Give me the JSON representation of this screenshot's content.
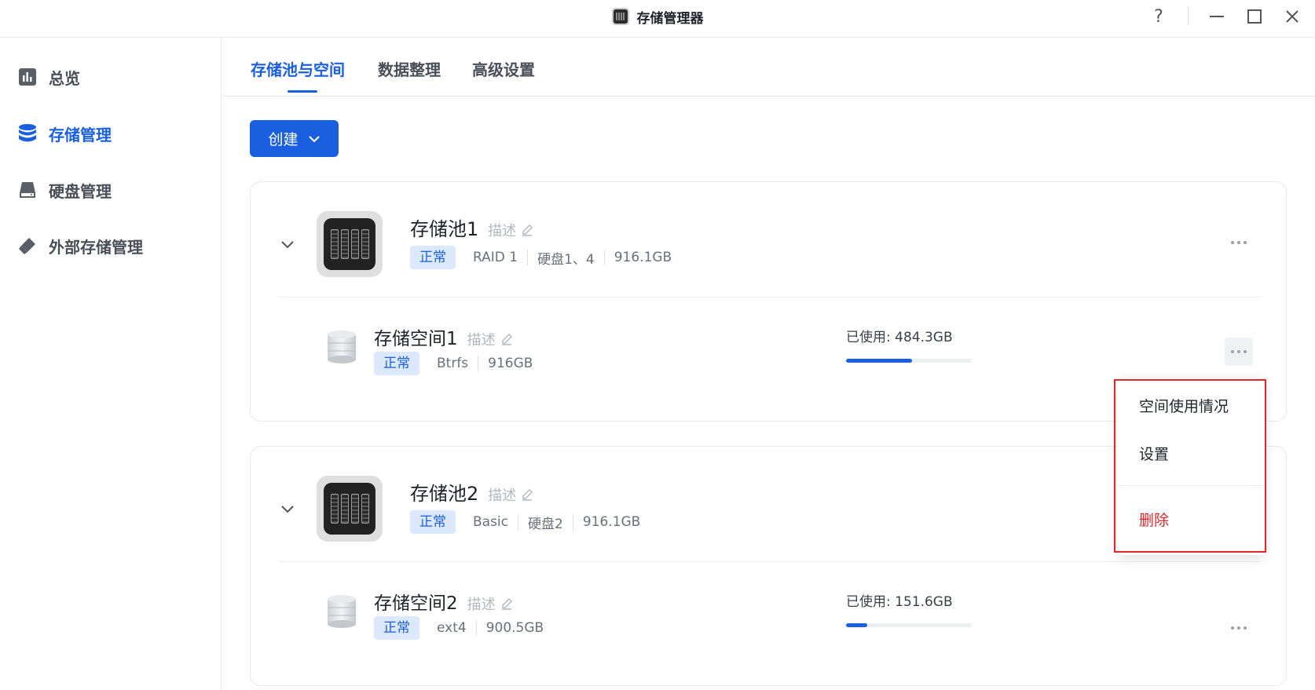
{
  "window": {
    "title": "存储管理器",
    "help": "?",
    "minimize": "—",
    "maximize": "☐",
    "close": "✕"
  },
  "sidebar": {
    "items": [
      {
        "label": "总览",
        "icon": "bar-chart-icon"
      },
      {
        "label": "存储管理",
        "icon": "database-icon",
        "active": true
      },
      {
        "label": "硬盘管理",
        "icon": "hard-disk-icon"
      },
      {
        "label": "外部存储管理",
        "icon": "usb-drive-icon"
      }
    ]
  },
  "tabs": [
    {
      "label": "存储池与空间",
      "active": true
    },
    {
      "label": "数据整理"
    },
    {
      "label": "高级设置"
    }
  ],
  "toolbar": {
    "create_label": "创建"
  },
  "pools": [
    {
      "name": "存储池1",
      "desc": "描述",
      "status": "正常",
      "raid": "RAID 1",
      "disks": "硬盘1、4",
      "size": "916.1GB",
      "volume": {
        "name": "存储空间1",
        "desc": "描述",
        "status": "正常",
        "fs": "Btrfs",
        "size": "916GB",
        "used_label": "已使用: 484.3GB",
        "used_fraction": 0.528
      }
    },
    {
      "name": "存储池2",
      "desc": "描述",
      "status": "正常",
      "raid": "Basic",
      "disks": "硬盘2",
      "size": "916.1GB",
      "volume": {
        "name": "存储空间2",
        "desc": "描述",
        "status": "正常",
        "fs": "ext4",
        "size": "900.5GB",
        "used_label": "已使用: 151.6GB",
        "used_fraction": 0.168
      }
    }
  ],
  "context_menu": {
    "items": [
      {
        "label": "空间使用情况"
      },
      {
        "label": "设置"
      },
      {
        "label": "删除",
        "danger": true
      }
    ]
  },
  "colors": {
    "accent": "#1a5fe0",
    "danger": "#e5252a",
    "badge_bg": "#dce8fd"
  }
}
